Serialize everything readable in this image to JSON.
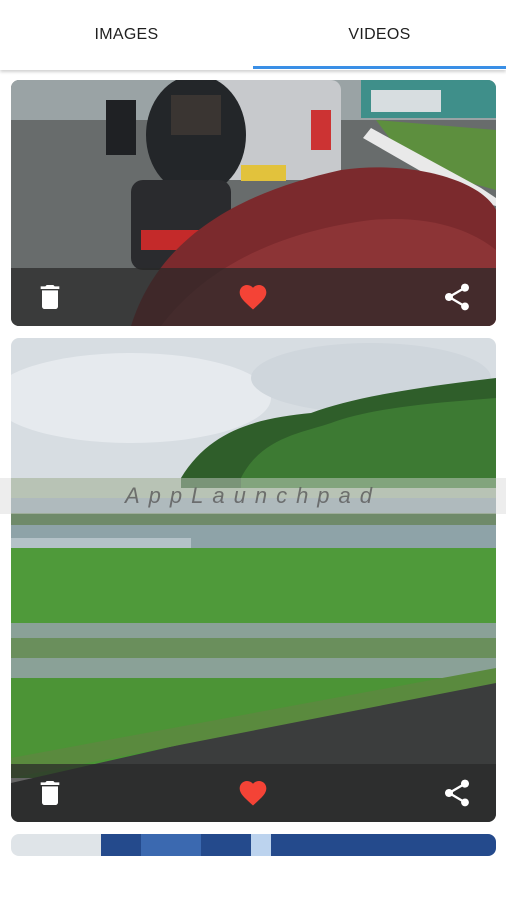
{
  "tabs": {
    "images_label": "IMAGES",
    "videos_label": "VIDEOS",
    "selected": "VIDEOS"
  },
  "watermark": "AppLaunchpad",
  "colors": {
    "accent": "#3a8fe6",
    "heart": "#f44336",
    "overlay": "#2a2a2a"
  },
  "cards": [
    {
      "actions": [
        "delete-icon",
        "heart-icon",
        "share-icon"
      ],
      "favorite": true
    },
    {
      "actions": [
        "delete-icon",
        "heart-icon",
        "share-icon"
      ],
      "favorite": true
    },
    {
      "actions": [],
      "favorite": false
    }
  ]
}
